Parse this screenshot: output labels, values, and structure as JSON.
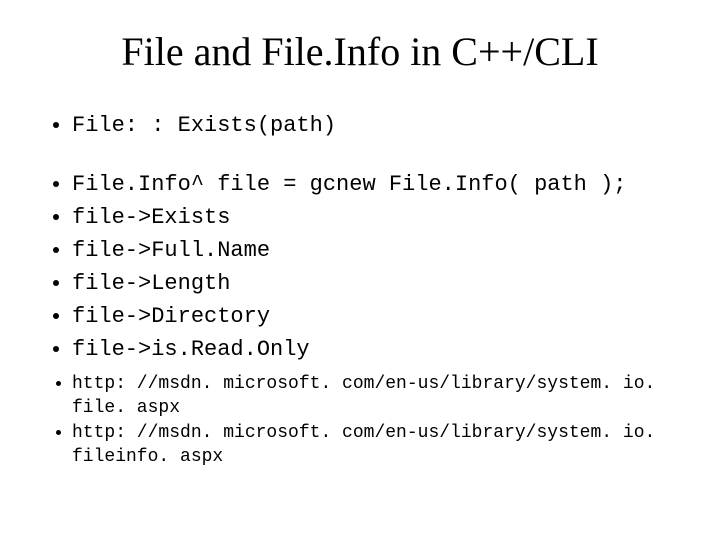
{
  "title": "File and File.Info in C++/CLI",
  "bullets_code_top": [
    "File: : Exists(path)"
  ],
  "bullets_code_mid": [
    "File.Info^ file = gcnew File.Info( path );",
    "file->Exists",
    "file->Full.Name",
    "file->Length",
    "file->Directory",
    "file->is.Read.Only"
  ],
  "bullets_links": [
    "http: //msdn. microsoft. com/en-us/library/system. io. file. aspx",
    "http: //msdn. microsoft. com/en-us/library/system. io. fileinfo. aspx"
  ]
}
